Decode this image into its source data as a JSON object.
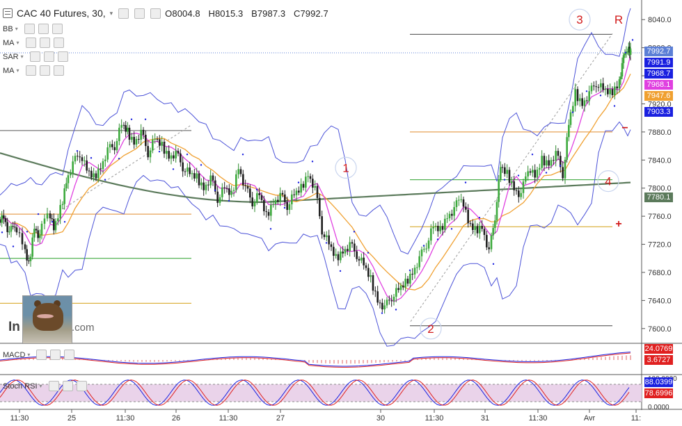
{
  "header": {
    "title": "CAC 40 Futures, 30,",
    "open_label": "O",
    "open": "8004.8",
    "high_label": "H",
    "high": "8015.3",
    "low_label": "B",
    "low": "7987.3",
    "close_label": "C",
    "close": "7992.7"
  },
  "indicators": [
    "BB",
    "MA",
    "SAR",
    "MA"
  ],
  "sub_indicators": {
    "macd": "MACD",
    "stoch": "Stoch RSI"
  },
  "watermark": {
    "left": "In",
    "right": ".com"
  },
  "price_tags": [
    {
      "text": "7992.7",
      "color": "#5b7fd6"
    },
    {
      "text": "7991.9",
      "color": "#1a20e0"
    },
    {
      "text": "7968.7",
      "color": "#1a20e0"
    },
    {
      "text": "7968.1",
      "color": "#e040e0"
    },
    {
      "text": "7947.6",
      "color": "#f0a030"
    },
    {
      "text": "7903.3",
      "color": "#1a20e0"
    },
    {
      "text": "7780.1",
      "color": "#5b7a5b"
    }
  ],
  "macd_tags": [
    {
      "text": "24.0769",
      "color": "#e02020"
    },
    {
      "text": "3.6727",
      "color": "#e02020"
    }
  ],
  "stoch_tags": [
    {
      "text": "88.0399",
      "color": "#1a20e0"
    },
    {
      "text": "78.6996",
      "color": "#e02020"
    }
  ],
  "wave_labels": [
    {
      "text": "1"
    },
    {
      "text": "2"
    },
    {
      "text": "3"
    },
    {
      "text": "4"
    },
    {
      "text": "R"
    }
  ],
  "markers": {
    "minus": "−",
    "plus": "+"
  },
  "chart_data": {
    "type": "candlestick",
    "title": "CAC 40 Futures, 30",
    "ylim": [
      7580,
      8060
    ],
    "y_ticks": [
      8040,
      8000,
      7960,
      7920,
      7880,
      7840,
      7800,
      7760,
      7720,
      7680,
      7640,
      7600
    ],
    "x_ticks": [
      "11:30",
      "25",
      "11:30",
      "26",
      "11:30",
      "27",
      "30",
      "11:30",
      "31",
      "11:30",
      "Avr",
      "11:"
    ],
    "stoch_ticks": [
      "100.0000",
      "80.0000",
      "0.0000"
    ],
    "close_path": [
      {
        "x": 0,
        "y": 7755
      },
      {
        "x": 8,
        "y": 7760
      },
      {
        "x": 16,
        "y": 7735
      },
      {
        "x": 24,
        "y": 7750
      },
      {
        "x": 36,
        "y": 7720
      },
      {
        "x": 44,
        "y": 7690
      },
      {
        "x": 52,
        "y": 7745
      },
      {
        "x": 60,
        "y": 7730
      },
      {
        "x": 72,
        "y": 7770
      },
      {
        "x": 80,
        "y": 7740
      },
      {
        "x": 90,
        "y": 7770
      },
      {
        "x": 98,
        "y": 7810
      },
      {
        "x": 108,
        "y": 7835
      },
      {
        "x": 118,
        "y": 7850
      },
      {
        "x": 128,
        "y": 7825
      },
      {
        "x": 138,
        "y": 7815
      },
      {
        "x": 148,
        "y": 7830
      },
      {
        "x": 158,
        "y": 7855
      },
      {
        "x": 168,
        "y": 7860
      },
      {
        "x": 178,
        "y": 7890
      },
      {
        "x": 186,
        "y": 7880
      },
      {
        "x": 196,
        "y": 7865
      },
      {
        "x": 206,
        "y": 7880
      },
      {
        "x": 216,
        "y": 7850
      },
      {
        "x": 226,
        "y": 7870
      },
      {
        "x": 236,
        "y": 7860
      },
      {
        "x": 246,
        "y": 7845
      },
      {
        "x": 256,
        "y": 7850
      },
      {
        "x": 266,
        "y": 7830
      },
      {
        "x": 276,
        "y": 7820
      },
      {
        "x": 286,
        "y": 7815
      },
      {
        "x": 296,
        "y": 7800
      },
      {
        "x": 306,
        "y": 7815
      },
      {
        "x": 316,
        "y": 7785
      },
      {
        "x": 326,
        "y": 7800
      },
      {
        "x": 336,
        "y": 7790
      },
      {
        "x": 346,
        "y": 7830
      },
      {
        "x": 356,
        "y": 7800
      },
      {
        "x": 366,
        "y": 7780
      },
      {
        "x": 376,
        "y": 7790
      },
      {
        "x": 386,
        "y": 7760
      },
      {
        "x": 396,
        "y": 7780
      },
      {
        "x": 406,
        "y": 7790
      },
      {
        "x": 416,
        "y": 7775
      },
      {
        "x": 426,
        "y": 7790
      },
      {
        "x": 436,
        "y": 7800
      },
      {
        "x": 446,
        "y": 7820
      },
      {
        "x": 456,
        "y": 7800
      },
      {
        "x": 466,
        "y": 7740
      },
      {
        "x": 476,
        "y": 7720
      },
      {
        "x": 486,
        "y": 7700
      },
      {
        "x": 496,
        "y": 7710
      },
      {
        "x": 506,
        "y": 7720
      },
      {
        "x": 516,
        "y": 7705
      },
      {
        "x": 526,
        "y": 7690
      },
      {
        "x": 536,
        "y": 7670
      },
      {
        "x": 546,
        "y": 7640
      },
      {
        "x": 556,
        "y": 7630
      },
      {
        "x": 566,
        "y": 7645
      },
      {
        "x": 576,
        "y": 7655
      },
      {
        "x": 586,
        "y": 7665
      },
      {
        "x": 596,
        "y": 7680
      },
      {
        "x": 606,
        "y": 7700
      },
      {
        "x": 616,
        "y": 7720
      },
      {
        "x": 626,
        "y": 7745
      },
      {
        "x": 636,
        "y": 7740
      },
      {
        "x": 646,
        "y": 7760
      },
      {
        "x": 656,
        "y": 7770
      },
      {
        "x": 666,
        "y": 7790
      },
      {
        "x": 676,
        "y": 7750
      },
      {
        "x": 686,
        "y": 7740
      },
      {
        "x": 696,
        "y": 7745
      },
      {
        "x": 706,
        "y": 7710
      },
      {
        "x": 714,
        "y": 7760
      },
      {
        "x": 722,
        "y": 7830
      },
      {
        "x": 732,
        "y": 7820
      },
      {
        "x": 742,
        "y": 7800
      },
      {
        "x": 752,
        "y": 7790
      },
      {
        "x": 762,
        "y": 7830
      },
      {
        "x": 772,
        "y": 7815
      },
      {
        "x": 782,
        "y": 7840
      },
      {
        "x": 792,
        "y": 7835
      },
      {
        "x": 802,
        "y": 7850
      },
      {
        "x": 812,
        "y": 7820
      },
      {
        "x": 820,
        "y": 7890
      },
      {
        "x": 830,
        "y": 7935
      },
      {
        "x": 840,
        "y": 7920
      },
      {
        "x": 850,
        "y": 7935
      },
      {
        "x": 860,
        "y": 7950
      },
      {
        "x": 870,
        "y": 7940
      },
      {
        "x": 880,
        "y": 7935
      },
      {
        "x": 890,
        "y": 7945
      },
      {
        "x": 896,
        "y": 7975
      },
      {
        "x": 902,
        "y": 8000
      },
      {
        "x": 906,
        "y": 7993
      }
    ],
    "horizontal_levels": [
      {
        "x1": 0,
        "x2": 275,
        "y": 7882,
        "color": "#555"
      },
      {
        "x1": 0,
        "x2": 275,
        "y": 7763,
        "color": "#e08a2a"
      },
      {
        "x1": 0,
        "x2": 275,
        "y": 7700,
        "color": "#2ca02c"
      },
      {
        "x1": 0,
        "x2": 275,
        "y": 7636,
        "color": "#d4a017"
      },
      {
        "x1": 589,
        "x2": 880,
        "y": 8019,
        "color": "#444"
      },
      {
        "x1": 589,
        "x2": 880,
        "y": 7880,
        "color": "#e08a2a"
      },
      {
        "x1": 589,
        "x2": 880,
        "y": 7812,
        "color": "#2ca02c"
      },
      {
        "x1": 589,
        "x2": 880,
        "y": 7745,
        "color": "#d4a017"
      },
      {
        "x1": 589,
        "x2": 880,
        "y": 7604,
        "color": "#444"
      }
    ]
  }
}
